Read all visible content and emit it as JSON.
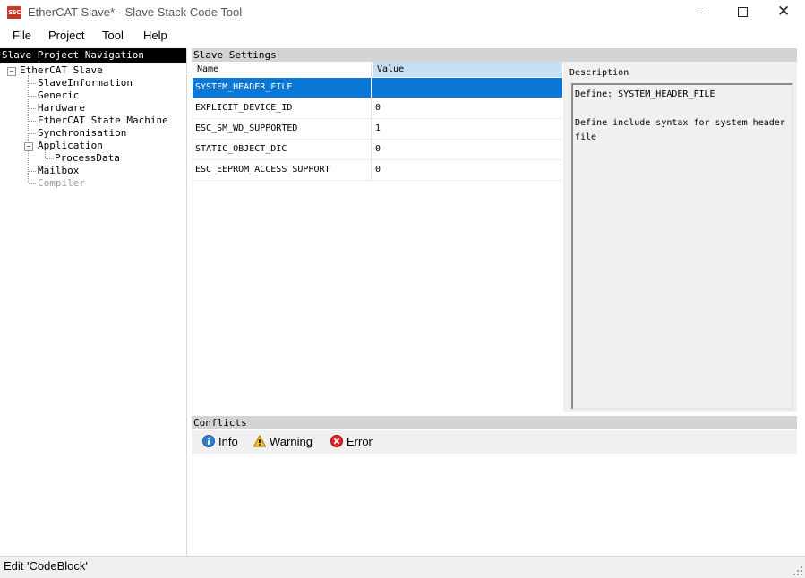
{
  "window": {
    "title": "EtherCAT Slave* - Slave Stack Code Tool",
    "icon_text": "SSC",
    "minimize_icon": "minimize-icon",
    "maximize_icon": "maximize-icon",
    "close_icon": "close-icon",
    "close_glyph": "✕"
  },
  "menu": [
    "File",
    "Project",
    "Tool",
    "Help"
  ],
  "nav": {
    "header": "Slave Project Navigation",
    "root": "EtherCAT Slave",
    "items": [
      "SlaveInformation",
      "Generic",
      "Hardware",
      "EtherCAT State Machine",
      "Synchronisation",
      "Application",
      "ProcessData",
      "Mailbox",
      "Compiler"
    ],
    "toggle_collapse": "−"
  },
  "settings": {
    "header": "Slave Settings",
    "columns": [
      "Name",
      "Value"
    ],
    "rows": [
      {
        "name": "SYSTEM_HEADER_FILE",
        "value": ""
      },
      {
        "name": "EXPLICIT_DEVICE_ID",
        "value": "0"
      },
      {
        "name": "ESC_SM_WD_SUPPORTED",
        "value": "1"
      },
      {
        "name": "STATIC_OBJECT_DIC",
        "value": "0"
      },
      {
        "name": "ESC_EEPROM_ACCESS_SUPPORT",
        "value": "0"
      }
    ],
    "selected_row": 0
  },
  "description": {
    "label": "Description",
    "line1": "Define: SYSTEM_HEADER_FILE",
    "line2": "Define include syntax for system header file"
  },
  "conflicts": {
    "header": "Conflicts",
    "buttons": [
      {
        "label": "Info",
        "icon": "info-icon"
      },
      {
        "label": "Warning",
        "icon": "warning-icon"
      },
      {
        "label": "Error",
        "icon": "error-icon"
      }
    ]
  },
  "status": {
    "text": "Edit 'CodeBlock'"
  },
  "colors": {
    "selection": "#0a78d7",
    "nav_header_bg": "#000000",
    "value_header_bg": "#c8dff3",
    "app_icon": "#c0392b"
  }
}
